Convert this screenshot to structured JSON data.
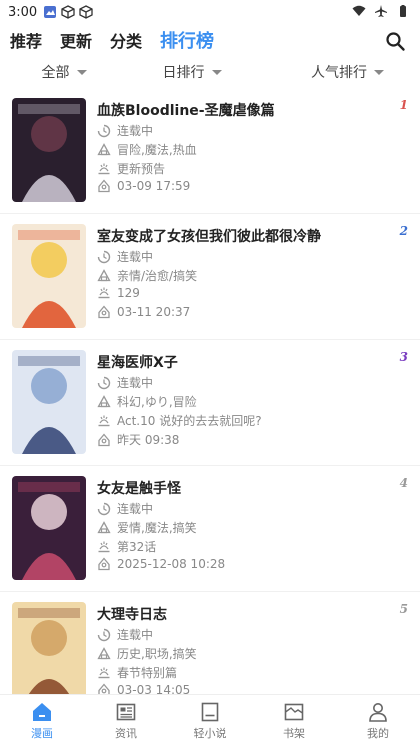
{
  "status": {
    "time": "3:00"
  },
  "tabs": [
    {
      "label": "推荐",
      "active": false
    },
    {
      "label": "更新",
      "active": false
    },
    {
      "label": "分类",
      "active": false
    },
    {
      "label": "排行榜",
      "active": true
    }
  ],
  "filters": {
    "scope": "全部",
    "period": "日排行",
    "sort": "人气排行"
  },
  "list": [
    {
      "rank": "1",
      "rank_color": "#d9534f",
      "title": "血族Bloodline-圣魔虐像篇",
      "status": "连载中",
      "tags": "冒险,魔法,热血",
      "latest": "更新预告",
      "date": "03-09 17:59",
      "cover_colors": [
        "#2a1f2e",
        "#c9c2cf",
        "#6a3a4a"
      ]
    },
    {
      "rank": "2",
      "rank_color": "#3b6fd0",
      "title": "室友变成了女孩但我们彼此都很冷静",
      "status": "连载中",
      "tags": "亲情/治愈/搞笑",
      "latest": "129",
      "date": "03-11 20:37",
      "cover_colors": [
        "#f5e8d6",
        "#e0562e",
        "#f2c84b"
      ]
    },
    {
      "rank": "3",
      "rank_color": "#7a3cc0",
      "title": "星海医师X子",
      "status": "连载中",
      "tags": "科幻,ゆり,冒险",
      "latest": "Act.10 说好的去去就回呢?",
      "date": "昨天 09:38",
      "cover_colors": [
        "#dfe6f2",
        "#3a4a7a",
        "#8aa4d0"
      ]
    },
    {
      "rank": "4",
      "rank_color": "#999999",
      "title": "女友是触手怪",
      "status": "连载中",
      "tags": "爱情,魔法,搞笑",
      "latest": "第32话",
      "date": "2025-12-08 10:28",
      "cover_colors": [
        "#3a1f3a",
        "#c0486a",
        "#e8d0d8"
      ]
    },
    {
      "rank": "5",
      "rank_color": "#999999",
      "title": "大理寺日志",
      "status": "连载中",
      "tags": "历史,职场,搞笑",
      "latest": "春节特别篇",
      "date": "03-03 14:05",
      "cover_colors": [
        "#f0d9a8",
        "#8a4a2a",
        "#d0a060"
      ]
    }
  ],
  "nav": [
    {
      "label": "漫画",
      "icon": "home-icon",
      "active": true
    },
    {
      "label": "资讯",
      "icon": "news-icon",
      "active": false
    },
    {
      "label": "轻小说",
      "icon": "book-icon",
      "active": false
    },
    {
      "label": "书架",
      "icon": "shelf-icon",
      "active": false
    },
    {
      "label": "我的",
      "icon": "user-icon",
      "active": false
    }
  ],
  "colors": {
    "accent": "#3b8ff0",
    "meta": "#888888",
    "title": "#222222"
  }
}
